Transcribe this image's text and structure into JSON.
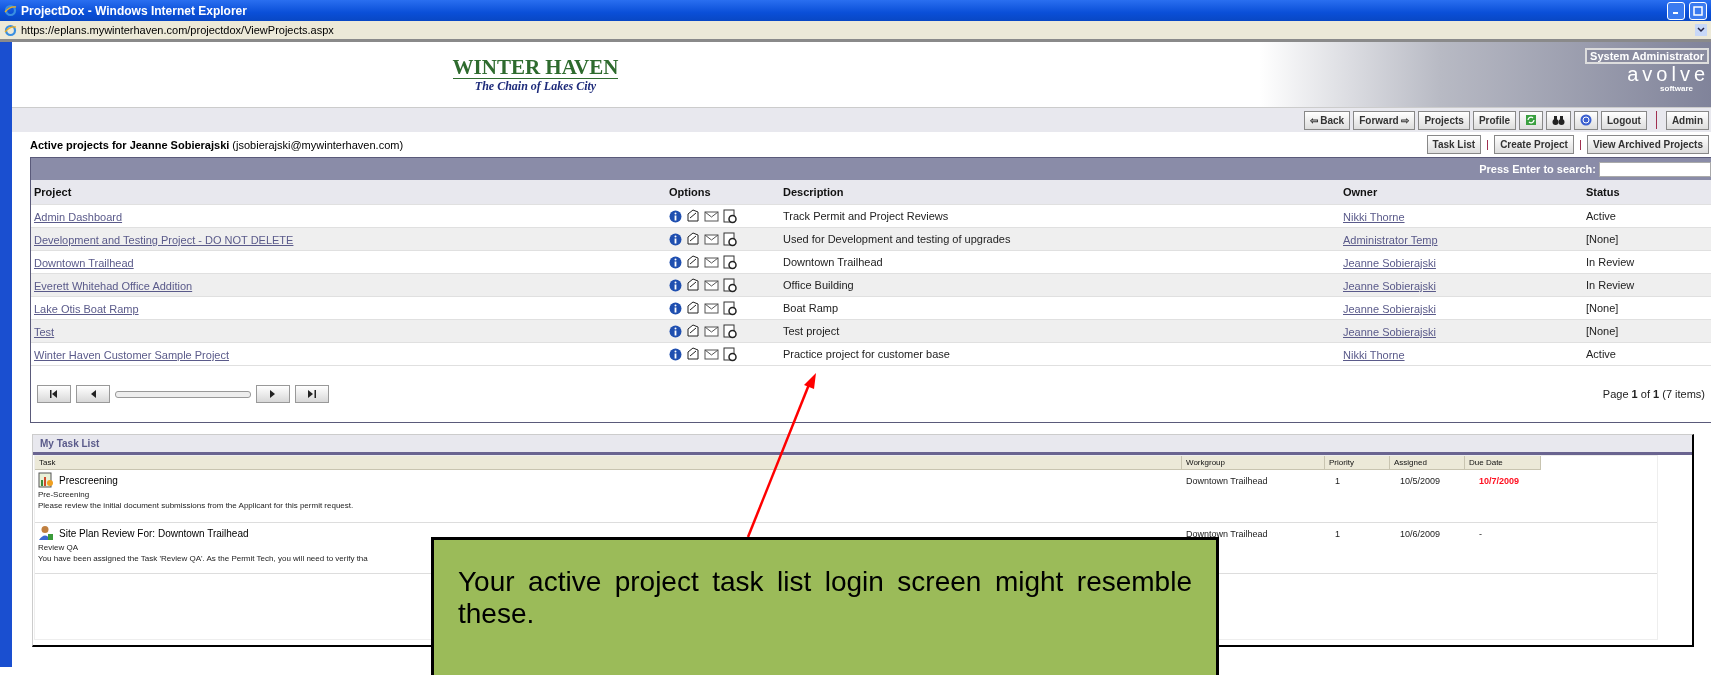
{
  "window": {
    "title": "ProjectDox - Windows Internet Explorer"
  },
  "address_bar": {
    "url": "https://eplans.mywinterhaven.com/projectdox/ViewProjects.aspx"
  },
  "header": {
    "logo_title": "WINTER HAVEN",
    "logo_tagline": "The Chain of Lakes City",
    "role_badge": "System Administrator",
    "vendor_name": "avolve",
    "vendor_sub": "software"
  },
  "nav_buttons": [
    {
      "label": "⇦ Back",
      "kind": "text"
    },
    {
      "label": "Forward ⇨",
      "kind": "text"
    },
    {
      "label": "Projects",
      "kind": "text"
    },
    {
      "label": "Profile",
      "kind": "text"
    },
    {
      "kind": "refresh"
    },
    {
      "kind": "search"
    },
    {
      "kind": "help"
    },
    {
      "label": "Logout",
      "kind": "text"
    },
    {
      "kind": "separator"
    },
    {
      "label": "Admin",
      "kind": "text"
    }
  ],
  "heading": "**Active projects for Jeanne Sobierajski** (jsobierajski@mywinterhaven.com)",
  "action_buttons": [
    "Task List",
    "Create Project",
    "View Archived Projects"
  ],
  "search": {
    "label": "Press Enter to search:"
  },
  "projects": {
    "columns": [
      "Project",
      "Options",
      "Description",
      "Owner",
      "Status"
    ],
    "rows": [
      {
        "project": "Admin Dashboard",
        "description": "Track Permit and Project Reviews",
        "owner": "Nikki Thorne",
        "status": "Active"
      },
      {
        "project": "Development and Testing Project - DO NOT DELETE",
        "description": "Used for Development and testing of upgrades",
        "owner": "Administrator Temp",
        "status": "[None]"
      },
      {
        "project": "Downtown Trailhead",
        "description": "Downtown Trailhead",
        "owner": "Jeanne Sobierajski",
        "status": "In Review"
      },
      {
        "project": "Everett Whitehad Office Addition",
        "description": "Office Building",
        "owner": "Jeanne Sobierajski",
        "status": "In Review"
      },
      {
        "project": "Lake Otis Boat Ramp",
        "description": "Boat Ramp",
        "owner": "Jeanne Sobierajski",
        "status": "[None]"
      },
      {
        "project": "Test",
        "description": "Test project",
        "owner": "Jeanne Sobierajski",
        "status": "[None]"
      },
      {
        "project": "Winter Haven Customer Sample Project",
        "description": "Practice project for customer base",
        "owner": "Nikki Thorne",
        "status": "Active"
      }
    ],
    "pager": "Page **1** of **1** (7 items)"
  },
  "task_list": {
    "title": "My Task List",
    "columns": [
      "Task",
      "Workgroup",
      "Priority",
      "Assigned",
      "Due Date"
    ],
    "rows": [
      {
        "kind": "document",
        "name": "Prescreening",
        "step": "Pre-Screening",
        "note": "Please review the initial document submissions from the Applicant for this permit request.",
        "workgroup": "Downtown Trailhead",
        "priority": "1",
        "assigned": "10/5/2009",
        "due": "10/7/2009",
        "overdue": true
      },
      {
        "kind": "person",
        "name": "Site Plan Review For: Downtown Trailhead",
        "step": "Review QA",
        "note": "You have been assigned the Task 'Review QA'. As the Permit Tech, you will need to verify tha",
        "workgroup": "Downtown Trailhead",
        "priority": "1",
        "assigned": "10/6/2009",
        "due": "-",
        "overdue": false
      }
    ]
  },
  "callout": {
    "text": "Your active project task list login screen might resemble these."
  }
}
